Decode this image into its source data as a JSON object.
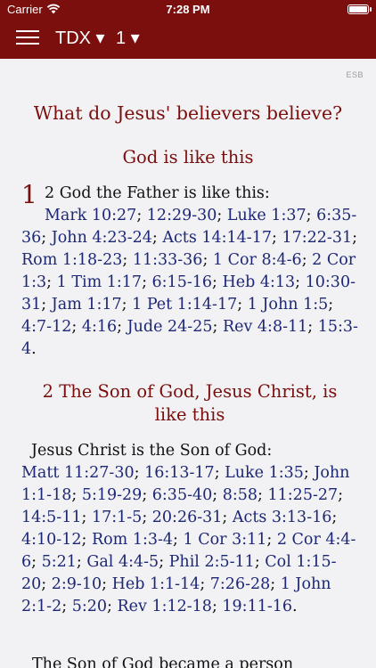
{
  "status_bar": {
    "carrier": "Carrier",
    "time": "7:28 PM"
  },
  "nav": {
    "book": "TDX ▾",
    "chapter": "1 ▾"
  },
  "version_label": "ESB",
  "title": "What do Jesus' believers believe?",
  "section1": {
    "heading": "God is like this",
    "verse_number": "1",
    "lead": "2 God the Father is like this:",
    "refs": [
      "Mark 10:27",
      "12:29-30",
      "Luke 1:37",
      "6:35-36",
      "John 4:23-24",
      "Acts 14:14-17",
      "17:22-31",
      "Rom 1:18-23",
      "11:33-36",
      "1 Cor 8:4-6",
      "2 Cor 1:3",
      "1 Tim 1:17",
      "6:15-16",
      "Heb 4:13",
      "10:30-31",
      "Jam 1:17",
      "1 Pet 1:14-17",
      "1 John 1:5",
      "4:7-12",
      "4:16",
      "Jude 24-25",
      "Rev 4:8-11",
      "15:3-4"
    ]
  },
  "section2": {
    "heading": "2 The Son of God, Jesus Christ, is like this",
    "lead": "Jesus Christ is the Son of God:",
    "refs": [
      "Matt 11:27-30",
      "16:13-17",
      "Luke 1:35",
      "John 1:1-18",
      "5:19-29",
      "6:35-40",
      "8:58",
      "11:25-27",
      "14:5-11",
      "17:1-5",
      "20:26-31",
      "Acts 3:13-16",
      "4:10-12",
      "Rom 1:3-4",
      "1 Cor 3:11",
      "2 Cor 4:4-6",
      "5:21",
      "Gal 4:4-5",
      "Phil 2:5-11",
      "Col 1:15-20",
      "2:9-10",
      "Heb 1:1-14",
      "7:26-28",
      "1 John 2:1-2",
      "5:20",
      "Rev 1:12-18",
      "19:11-16"
    ],
    "next_line": "The Son of God became a person"
  },
  "colors": {
    "brand": "#7a0f0e",
    "link": "#1c2775",
    "background": "#f2f1f3"
  }
}
